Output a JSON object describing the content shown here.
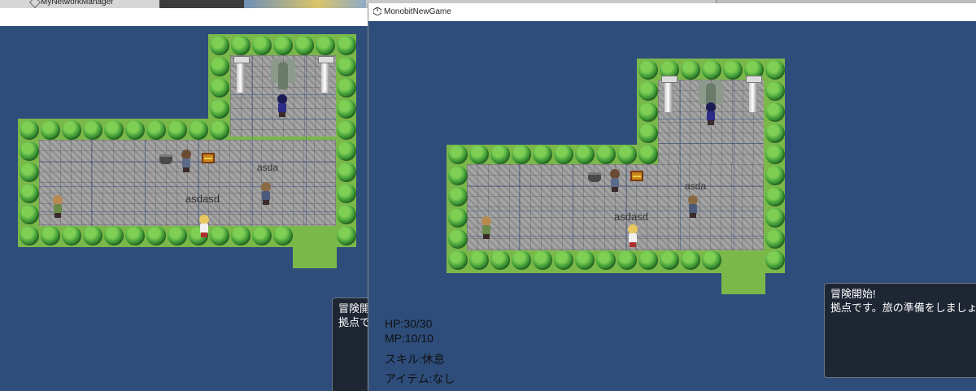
{
  "editor": {
    "hierarchy_item": "MyNetworkManager"
  },
  "window": {
    "title": "MonobitNewGame"
  },
  "left_view": {
    "player_labels": [
      "asda",
      "asdasd"
    ],
    "message": {
      "line1": "冒険開",
      "line2": "拠点で"
    }
  },
  "right_view": {
    "player_labels": [
      "asda",
      "asdasd"
    ],
    "message": {
      "line1": "冒険開始!",
      "line2": "拠点です。旅の準備をしましょう。"
    },
    "stats": {
      "hp": "HP:30/30",
      "mp": "MP:10/10",
      "skill": "スキル:休息",
      "item": "アイテム:なし"
    }
  },
  "colors": {
    "background": "#2e4d7b",
    "grass": "#7bb84a",
    "message_box": "#1e2533"
  }
}
